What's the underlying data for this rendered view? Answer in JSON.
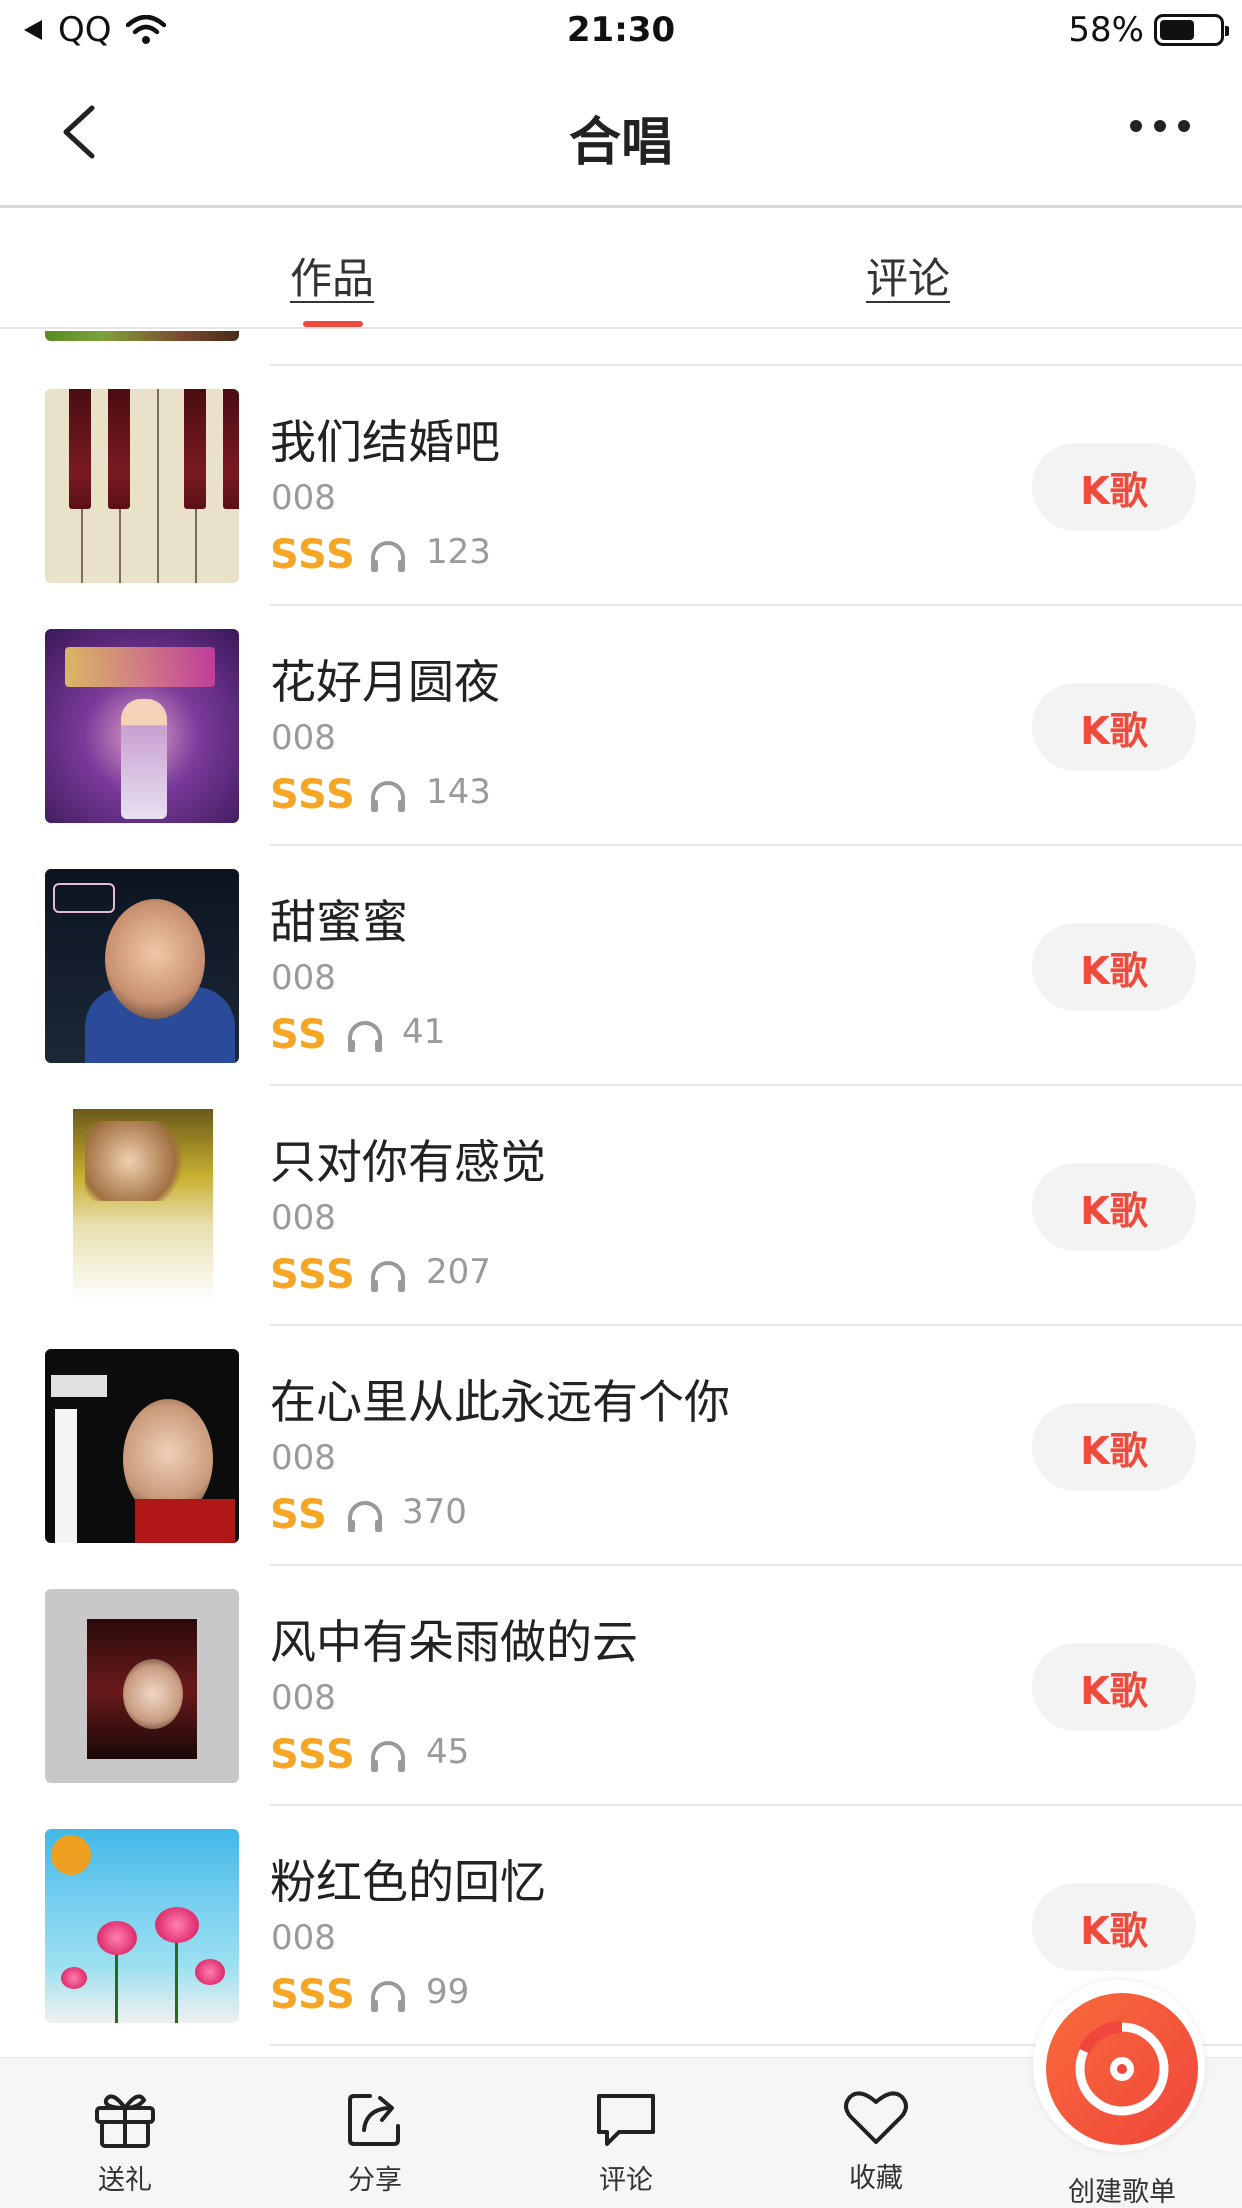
{
  "status_bar": {
    "carrier": "QQ",
    "time": "21:30",
    "battery": "58%",
    "battery_level": 0.58
  },
  "nav": {
    "title": "合唱"
  },
  "tabs": [
    {
      "label": "作品",
      "active": true
    },
    {
      "label": "评论",
      "active": false
    }
  ],
  "songs": [
    {
      "title": "我们结婚吧",
      "singer": "008",
      "rank": "SSS",
      "plays": "123",
      "button": "K歌"
    },
    {
      "title": "花好月圆夜",
      "singer": "008",
      "rank": "SSS",
      "plays": "143",
      "button": "K歌"
    },
    {
      "title": "甜蜜蜜",
      "singer": "008",
      "rank": "SS",
      "plays": "41",
      "button": "K歌"
    },
    {
      "title": "只对你有感觉",
      "singer": "008",
      "rank": "SSS",
      "plays": "207",
      "button": "K歌"
    },
    {
      "title": "在心里从此永远有个你",
      "singer": "008",
      "rank": "SS",
      "plays": "370",
      "button": "K歌"
    },
    {
      "title": "风中有朵雨做的云",
      "singer": "008",
      "rank": "SSS",
      "plays": "45",
      "button": "K歌"
    },
    {
      "title": "粉红色的回忆",
      "singer": "008",
      "rank": "SSS",
      "plays": "99",
      "button": "K歌"
    }
  ],
  "bottom_bar": {
    "gift": "送礼",
    "share": "分享",
    "comment": "评论",
    "favorite": "收藏",
    "create_playlist": "创建歌单"
  },
  "colors": {
    "accent": "#f04a3c",
    "rank": "#f5a623",
    "muted": "#9a9a9a"
  }
}
